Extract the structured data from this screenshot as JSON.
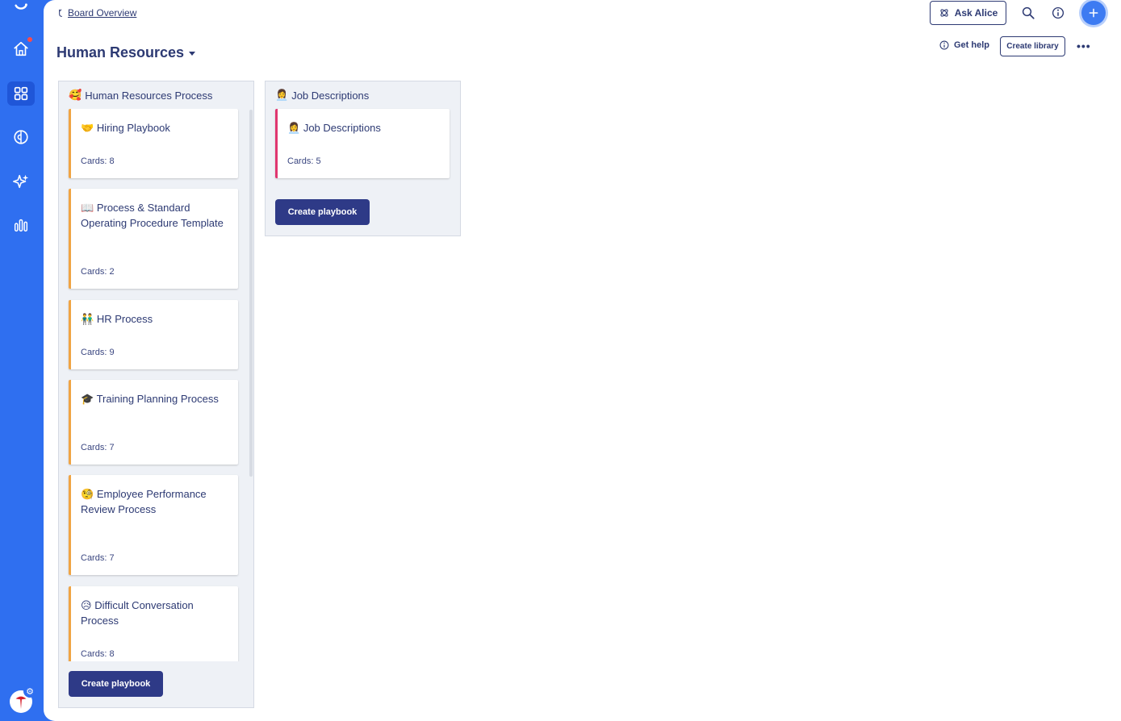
{
  "colors": {
    "rail": "#2f6ff0",
    "primary_button": "#2e3a87",
    "text": "#2d3a73",
    "card_accent_orange": "#f0a444",
    "card_accent_pink": "#e0366f"
  },
  "breadcrumb": {
    "label": "Board Overview"
  },
  "page_title": "Human Resources",
  "header": {
    "ask_label": "Ask Alice",
    "help_label": "Get help",
    "create_library_label": "Create library"
  },
  "columns": [
    {
      "title": "Human Resources Process",
      "emoji": "🥰",
      "create_label": "Create playbook",
      "cards": [
        {
          "emoji": "🤝",
          "title": "Hiring Playbook",
          "count": "Cards: 8"
        },
        {
          "emoji": "📖",
          "title": "Process & Standard Operating Procedure Template",
          "count": "Cards: 2"
        },
        {
          "emoji": "👬",
          "title": "HR Process",
          "count": "Cards: 9"
        },
        {
          "emoji": "🎓",
          "title": "Training Planning Process",
          "count": "Cards: 7"
        },
        {
          "emoji": "🧐",
          "title": "Employee Performance Review Process",
          "count": "Cards: 7"
        },
        {
          "emoji": "😥",
          "title": "Difficult Conversation Process",
          "count": "Cards: 8"
        }
      ]
    },
    {
      "title": "Job Descriptions",
      "emoji": "👩‍💼",
      "create_label": "Create playbook",
      "cards": [
        {
          "emoji": "👩‍💼",
          "title": "Job Descriptions",
          "count": "Cards: 5"
        }
      ]
    }
  ]
}
